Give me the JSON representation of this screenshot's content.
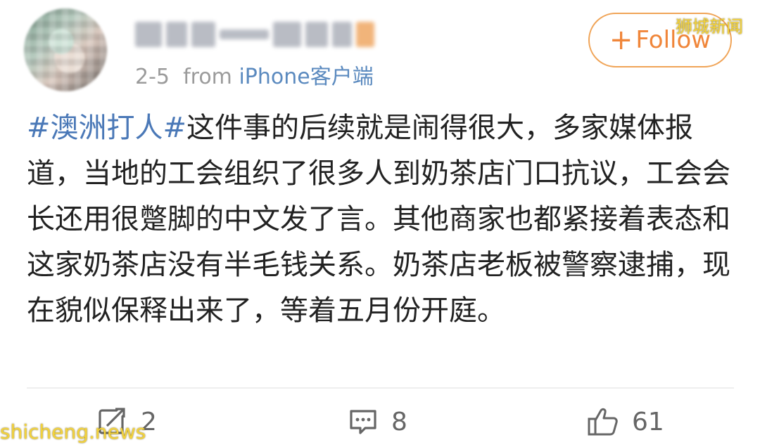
{
  "post": {
    "date": "2-5",
    "from_label": "from",
    "source": "iPhone客户端",
    "hashtag": "#澳洲打人#",
    "body": "这件事的后续就是闹得很大，多家媒体报道，当地的工会组织了很多人到奶茶店门口抗议，工会会长还用很蹩脚的中文发了言。其他商家也都紧接着表态和这家奶茶店没有半毛钱关系。奶茶店老板被警察逮捕，现在貌似保释出来了，等着五月份开庭。"
  },
  "follow_button": {
    "label": "Follow",
    "icon": "plus-icon"
  },
  "actions": {
    "repost": {
      "count": "2",
      "icon": "repost-icon"
    },
    "comment": {
      "count": "8",
      "icon": "comment-icon"
    },
    "like": {
      "count": "61",
      "icon": "thumbs-up-icon"
    }
  },
  "watermarks": {
    "top_right": "狮城新闻",
    "bottom_left": "shicheng.news"
  },
  "colors": {
    "link": "#4a78b7",
    "follow": "#f0863a",
    "meta": "#9b9b9b",
    "watermark": "#f3d23b"
  }
}
